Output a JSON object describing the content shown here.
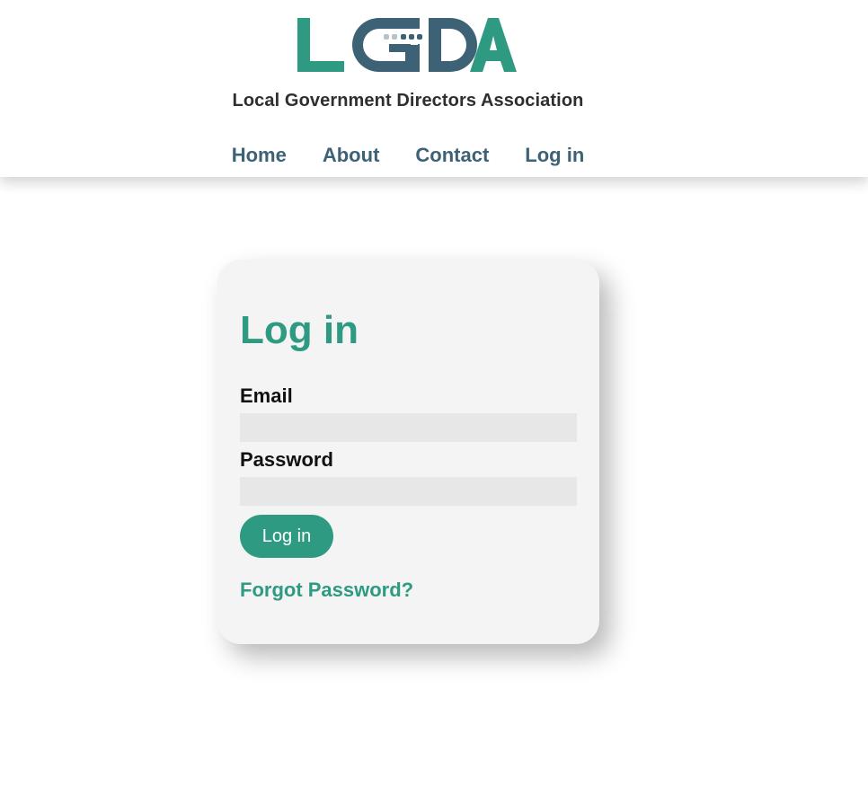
{
  "header": {
    "logo_text": "LGDA",
    "tagline": "Local Government Directors Association",
    "nav": [
      {
        "label": "Home"
      },
      {
        "label": "About"
      },
      {
        "label": "Contact"
      },
      {
        "label": "Log in"
      }
    ]
  },
  "login": {
    "title": "Log in",
    "email_label": "Email",
    "email_value": "",
    "password_label": "Password",
    "password_value": "",
    "submit_label": "Log in",
    "forgot_label": "Forgot Password?"
  },
  "colors": {
    "brand_teal": "#2e9a82",
    "brand_slate": "#3d6275",
    "card_bg": "#f4f4f4",
    "input_bg": "#e7e7e7"
  },
  "icons": [
    "lgda-logo"
  ]
}
